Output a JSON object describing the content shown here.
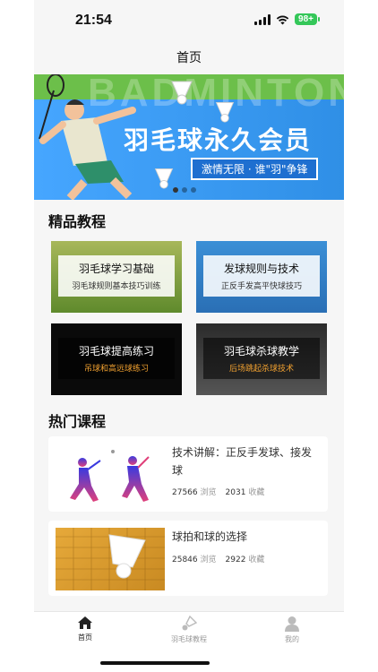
{
  "status_bar": {
    "time": "21:54",
    "battery": "98+"
  },
  "navbar": {
    "title": "首页"
  },
  "banner": {
    "bg_text": "BADMINTON",
    "title": "羽毛球永久会员",
    "slogan": "激情无限 · 谁\"羽\"争锋",
    "dots": 3,
    "active_dot": 0
  },
  "featured": {
    "section_title": "精品教程",
    "cards": [
      {
        "title": "羽毛球学习基础",
        "subtitle": "羽毛球规则基本技巧训练"
      },
      {
        "title": "发球规则与技术",
        "subtitle": "正反手发高平快球技巧"
      },
      {
        "title": "羽毛球提高练习",
        "subtitle": "吊球和高远球练习"
      },
      {
        "title": "羽毛球杀球教学",
        "subtitle": "后场跳起杀球技术"
      }
    ]
  },
  "hot": {
    "section_title": "热门课程",
    "items": [
      {
        "title": "技术讲解：正反手发球、接发球",
        "views": "27566",
        "views_label": "浏览",
        "favs": "2031",
        "favs_label": "收藏"
      },
      {
        "title": "球拍和球的选择",
        "views": "25846",
        "views_label": "浏览",
        "favs": "2922",
        "favs_label": "收藏"
      }
    ]
  },
  "tabbar": {
    "tabs": [
      {
        "label": "首页",
        "icon": "home-icon",
        "active": true
      },
      {
        "label": "羽毛球教程",
        "icon": "shuttlecock-icon",
        "active": false
      },
      {
        "label": "我的",
        "icon": "user-icon",
        "active": false
      }
    ]
  },
  "colors": {
    "accent": "#2f8fe6",
    "banner_green": "#6cbf4a",
    "battery": "#34c759"
  }
}
